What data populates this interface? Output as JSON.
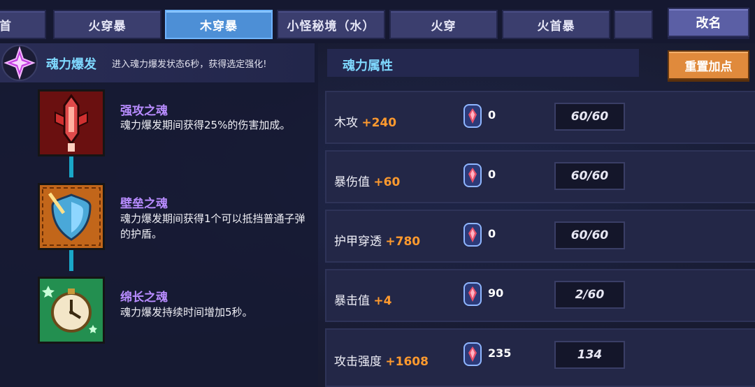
{
  "tabs": [
    {
      "label": "首"
    },
    {
      "label": "火穿暴"
    },
    {
      "label": "木穿暴"
    },
    {
      "label": "小怪秘境（水）"
    },
    {
      "label": "火穿"
    },
    {
      "label": "火首暴"
    },
    {
      "label": ""
    }
  ],
  "active_tab": "木穿暴",
  "rename_label": "改名",
  "reset_label": "重置加点",
  "burst": {
    "title": "魂力爆发",
    "desc": "进入魂力爆发状态6秒，获得选定强化!",
    "icon": "purple-star-icon"
  },
  "skills": [
    {
      "name": "强攻之魂",
      "desc": "魂力爆发期间获得25%的伤害加成。",
      "icon": "red-sword-icon"
    },
    {
      "name": "壁垒之魂",
      "desc": "魂力爆发期间获得1个可以抵挡普通子弹的护盾。",
      "icon": "orange-shield-icon"
    },
    {
      "name": "绵长之魂",
      "desc": "魂力爆发持续时间增加5秒。",
      "icon": "green-clock-icon"
    }
  ],
  "attributes_title": "魂力属性",
  "attributes": [
    {
      "name": "木攻",
      "bonus": "+240",
      "gems": "0",
      "level": "60/60"
    },
    {
      "name": "暴伤值",
      "bonus": "+60",
      "gems": "0",
      "level": "60/60"
    },
    {
      "name": "护甲穿透",
      "bonus": "+780",
      "gems": "0",
      "level": "60/60"
    },
    {
      "name": "暴击值",
      "bonus": "+4",
      "gems": "90",
      "level": "2/60"
    },
    {
      "name": "攻击强度",
      "bonus": "+1608",
      "gems": "235",
      "level": "134"
    }
  ],
  "colors": {
    "accent_cyan": "#7fd9ff",
    "skill_name": "#b88cff",
    "bonus_orange": "#ff9a2e",
    "active_tab": "#4d8fd6",
    "reset_button": "#e08a3c"
  }
}
